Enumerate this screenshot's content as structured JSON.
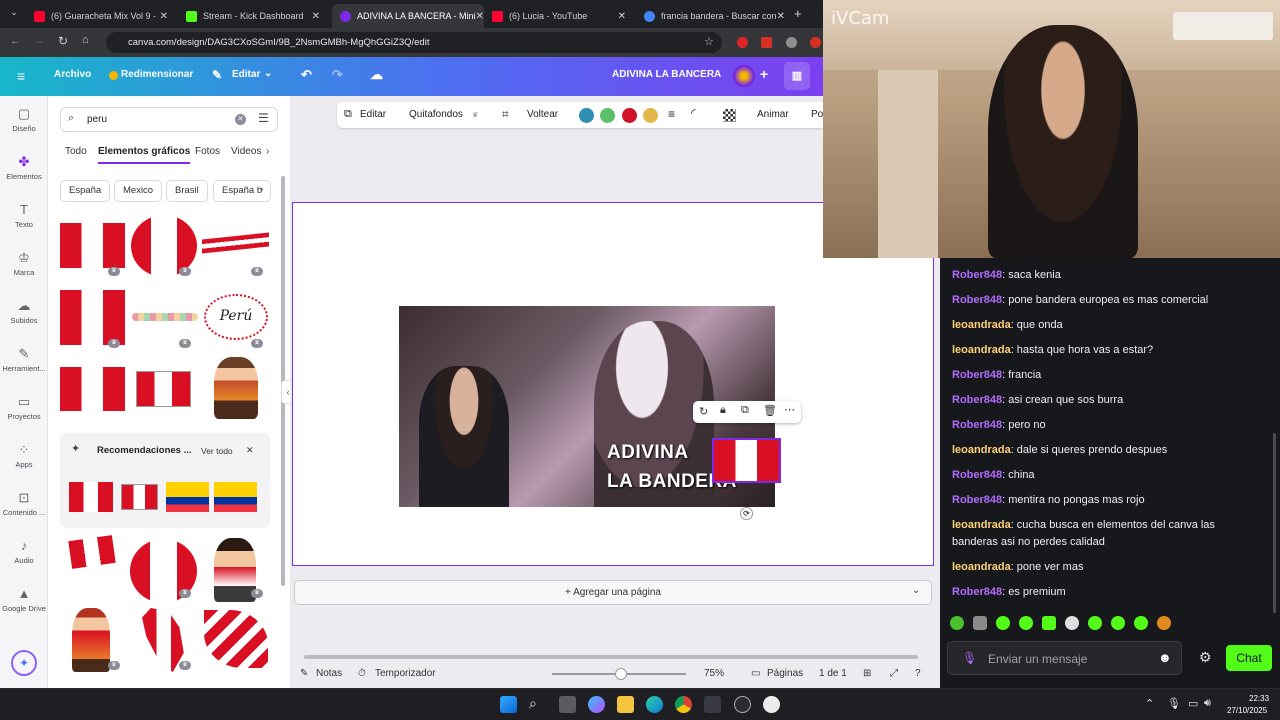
{
  "browser": {
    "tabs": [
      {
        "label": "(6) Guaracheta Mix Vol 9 -",
        "color": "#ff0033"
      },
      {
        "label": "Stream - Kick Dashboard",
        "color": "#53fc18"
      },
      {
        "label": "ADIVINA LA BANCERA - Mini",
        "color": "#7d2ae8"
      },
      {
        "label": "(6) Lucia - YouTube",
        "color": "#ff0033"
      },
      {
        "label": "francia bandera - Buscar con",
        "color": "#4285f4"
      }
    ],
    "url": "canva.com/design/DAG3CXoSGmI/9B_2NsmGMBh-MgQhGGiZ3Q/edit"
  },
  "canva": {
    "menu": {
      "archivo": "Archivo",
      "redimensionar": "Redimensionar",
      "editar": "Editar",
      "doc_title": "ADIVINA LA BANCERA"
    },
    "rail": [
      "Diseño",
      "Elementos",
      "Texto",
      "Marca",
      "Subidos",
      "Herramient...",
      "Proyectos",
      "Apps",
      "Contenido ...",
      "Audio",
      "Google Drive"
    ],
    "search": {
      "value": "peru"
    },
    "panel_tabs": [
      "Todo",
      "Elementos gráficos",
      "Fotos",
      "Videos"
    ],
    "chips": [
      "España",
      "Mexico",
      "Brasil",
      "España b"
    ],
    "reco": {
      "title": "Recomendaciones ...",
      "see_all": "Ver todo"
    },
    "thumb_text": "Perú",
    "toolbar": {
      "editar": "Editar",
      "quitafondos": "Quitafondos",
      "voltear": "Voltear",
      "animar": "Animar",
      "cut": "Po"
    },
    "colors": [
      "#2d8fb3",
      "#5bbf6b",
      "#d0112a",
      "#e3b84a"
    ],
    "canvas_title_1": "ADIVINA",
    "canvas_title_2": "LA BANDERA",
    "add_page": "+ Agregar una página",
    "footer": {
      "notas": "Notas",
      "temporizador": "Temporizador",
      "zoom": "75%",
      "paginas": "Páginas",
      "page_count": "1 de 1"
    }
  },
  "cam": {
    "watermark": "iVCam"
  },
  "chat": {
    "messages": [
      {
        "user": "Rober848",
        "text": ": saca kenia",
        "color": "#b36bff"
      },
      {
        "user": "Rober848",
        "text": ": pone bandera europea es mas comercial",
        "color": "#b36bff"
      },
      {
        "user": "leoandrada",
        "text": ": que onda",
        "color": "#ffd27a"
      },
      {
        "user": "leoandrada",
        "text": ": hasta que hora vas a estar?",
        "color": "#ffd27a"
      },
      {
        "user": "Rober848",
        "text": ": francia",
        "color": "#b36bff"
      },
      {
        "user": "Rober848",
        "text": ": asi crean que sos burra",
        "color": "#b36bff"
      },
      {
        "user": "Rober848",
        "text": ": pero no",
        "color": "#b36bff"
      },
      {
        "user": "leoandrada",
        "text": ": dale si queres prendo despues",
        "color": "#ffd27a"
      },
      {
        "user": "Rober848",
        "text": ": china",
        "color": "#b36bff"
      },
      {
        "user": "Rober848",
        "text": ": mentira no pongas mas rojo",
        "color": "#b36bff"
      },
      {
        "user": "leoandrada",
        "text": ": cucha busca en elementos del canva las banderas asi no perdes calidad",
        "color": "#ffd27a"
      },
      {
        "user": "leoandrada",
        "text": ": pone ver mas",
        "color": "#ffd27a"
      },
      {
        "user": "Rober848",
        "text": ": es premium",
        "color": "#b36bff"
      }
    ],
    "placeholder": "Enviar un mensaje",
    "send": "Chat"
  },
  "taskbar": {
    "time": "22:33",
    "date": "27/10/2025"
  }
}
